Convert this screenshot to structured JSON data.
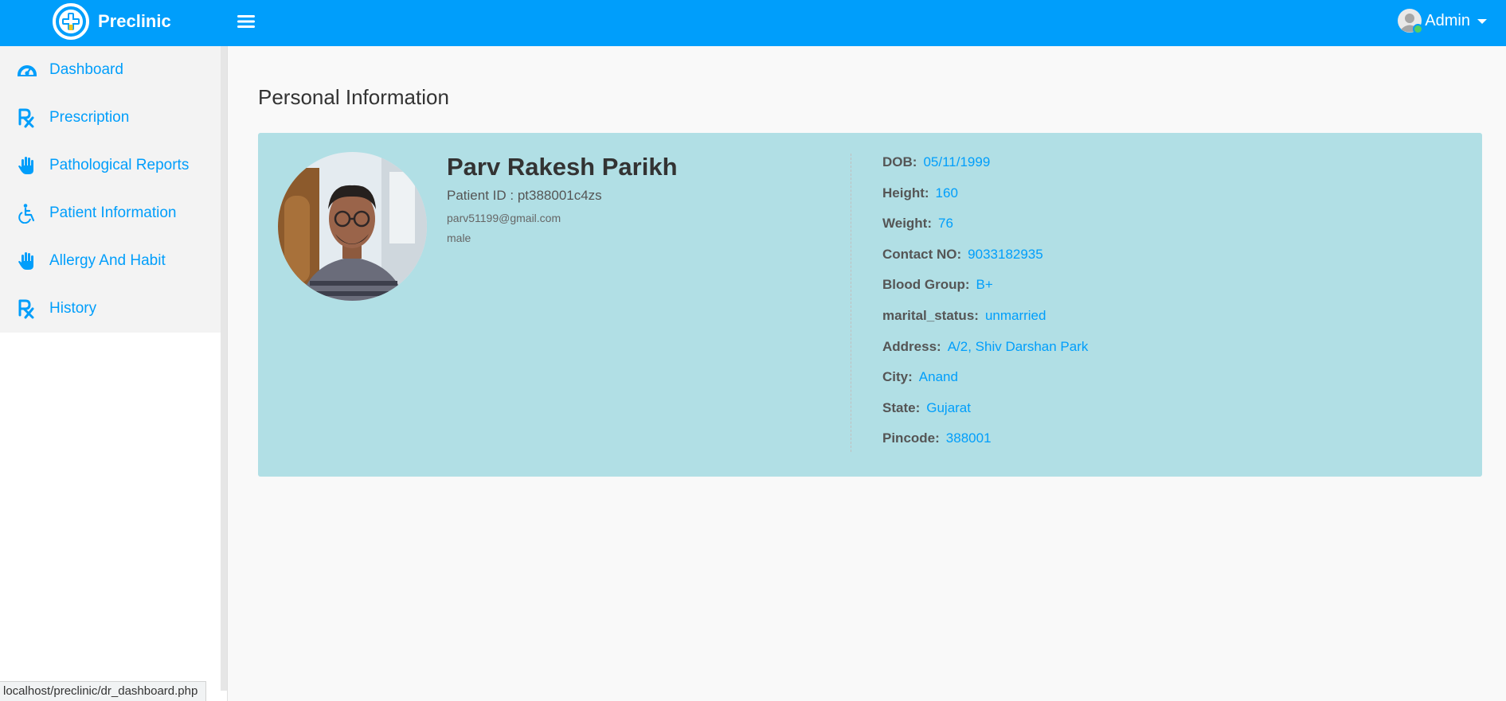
{
  "header": {
    "brand": "Preclinic",
    "user": {
      "name": "Admin",
      "status": "online"
    },
    "color": "#009efb"
  },
  "sidebar": {
    "items": [
      {
        "label": "Dashboard",
        "icon": "dashboard-icon"
      },
      {
        "label": "Prescription",
        "icon": "prescription-icon"
      },
      {
        "label": "Pathological Reports",
        "icon": "hand-icon"
      },
      {
        "label": "Patient Information",
        "icon": "wheelchair-icon"
      },
      {
        "label": "Allergy And Habit",
        "icon": "hand-icon"
      },
      {
        "label": "History",
        "icon": "prescription-icon"
      }
    ]
  },
  "main": {
    "title": "Personal Information",
    "profile": {
      "name": "Parv Rakesh Parikh",
      "patient_id": "Patient ID : pt388001c4zs",
      "email": "parv51199@gmail.com",
      "gender": "male",
      "details": [
        {
          "title": "DOB:",
          "value": "05/11/1999"
        },
        {
          "title": "Height:",
          "value": "160"
        },
        {
          "title": "Weight:",
          "value": "76"
        },
        {
          "title": "Contact NO:",
          "value": "9033182935"
        },
        {
          "title": "Blood Group:",
          "value": "B+"
        },
        {
          "title": "marital_status:",
          "value": "unmarried"
        },
        {
          "title": "Address:",
          "value": "A/2, Shiv Darshan Park"
        },
        {
          "title": "City:",
          "value": "Anand"
        },
        {
          "title": "State:",
          "value": "Gujarat"
        },
        {
          "title": "Pincode:",
          "value": "388001"
        }
      ]
    }
  },
  "status_bar": {
    "url": "localhost/preclinic/dr_dashboard.php"
  },
  "colors": {
    "accent": "#009efb",
    "card_bg": "#b1dfe5",
    "page_bg": "#f9f9f9",
    "online": "#55ce63"
  }
}
